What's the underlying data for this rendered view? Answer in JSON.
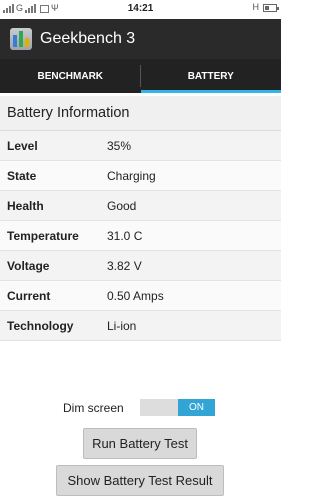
{
  "status_bar": {
    "carrier_left": "G",
    "network_right": "H",
    "time": "14:21",
    "battery_level": 0.35
  },
  "app": {
    "title": "Geekbench 3",
    "icon": "geekbench-app-icon"
  },
  "tabs": [
    {
      "label": "BENCHMARK",
      "active": false
    },
    {
      "label": "BATTERY",
      "active": true
    }
  ],
  "accent_color": "#33b5e5",
  "section": {
    "title": "Battery Information",
    "rows": [
      {
        "label": "Level",
        "value": "35%"
      },
      {
        "label": "State",
        "value": "Charging"
      },
      {
        "label": "Health",
        "value": "Good"
      },
      {
        "label": "Temperature",
        "value": "31.0 C"
      },
      {
        "label": "Voltage",
        "value": "3.82 V"
      },
      {
        "label": "Current",
        "value": "0.50 Amps"
      },
      {
        "label": "Technology",
        "value": "Li-ion"
      }
    ]
  },
  "dim_screen": {
    "label": "Dim screen",
    "state_label": "ON",
    "enabled": true
  },
  "buttons": {
    "run": "Run Battery Test",
    "show": "Show Battery Test Result"
  }
}
